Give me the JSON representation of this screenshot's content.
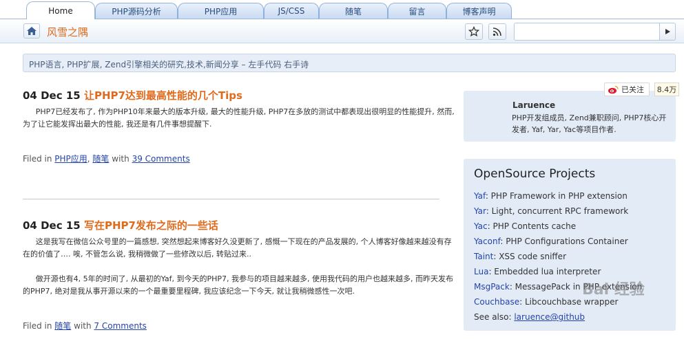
{
  "tabs": [
    {
      "label": "Home",
      "active": true
    },
    {
      "label": "PHP源码分析",
      "active": false
    },
    {
      "label": "PHP应用",
      "active": false
    },
    {
      "label": "JS/CSS",
      "active": false
    },
    {
      "label": "随笔",
      "active": false
    },
    {
      "label": "留言",
      "active": false
    },
    {
      "label": "博客声明",
      "active": false
    }
  ],
  "header": {
    "site_title": "风雪之隅",
    "search_placeholder": ""
  },
  "tagline": "PHP语言, PHP扩展, Zend引擎相关的研究,技术,新闻分享 – 左手代码 右手诗",
  "posts": [
    {
      "date": "04 Dec 15",
      "title": "让PHP7达到最高性能的几个Tips",
      "paragraphs": [
        "PHP7已经发布了, 作为PHP10年来最大的版本升级, 最大的性能升级, PHP7在多放的测试中都表现出很明显的性能提升, 然而, 为了让它能发挥出最大的性能, 我还是有几件事想提醒下."
      ],
      "filed_prefix": "Filed in",
      "categories": [
        "PHP应用",
        "随笔"
      ],
      "with_text": "with",
      "comments": "39 Comments"
    },
    {
      "date": "04 Dec 15",
      "title": "写在PHP7发布之际的一些话",
      "paragraphs": [
        "这是我写在微信公众号里的一篇感想, 突然想起来博客好久没更新了, 感慨一下现在的产品发展的, 个人博客好像越来越没有存在的价值了…. 唉, 不管怎么说, 我稍微做了一些修改以后, 转贴过来..",
        "做开源也有4, 5年的时间了, 从最初的Yaf, 到今天的PHP7, 我参与的项目越来越多, 使用我代码的用户也越来越多, 而昨天发布的PHP7, 绝对是我从事开源以来的一个最重要里程碑, 我应该纪念一下今天, 就让我稍微感性一次吧."
      ],
      "filed_prefix": "Filed in",
      "categories": [
        "随笔"
      ],
      "with_text": "with",
      "comments": "7 Comments"
    }
  ],
  "sidebar": {
    "weibo_follow": "已关注",
    "weibo_count": "8.4万",
    "profile_name": "Laruence",
    "profile_desc": "PHP开发组成员, Zend兼职顾问, PHP7核心开发者, Yaf, Yar, Yac等项目作者.",
    "opensource_title": "OpenSource Projects",
    "projects": [
      {
        "name": "Yaf",
        "desc": ": PHP Framework in PHP extension"
      },
      {
        "name": "Yar",
        "desc": ": Light, concurrent RPC framework"
      },
      {
        "name": "Yac",
        "desc": ": PHP Contents cache"
      },
      {
        "name": "Yaconf",
        "desc": ": PHP Configurations Container"
      },
      {
        "name": "Taint",
        "desc": ": XSS code sniffer"
      },
      {
        "name": "Lua",
        "desc": ": Embedded lua interpreter"
      },
      {
        "name": "MsgPack",
        "desc": ": MessagePack in PHP extension"
      },
      {
        "name": "Couchbase",
        "desc": ": Libcouchbase wrapper"
      }
    ],
    "see_also_label": "See also: ",
    "see_also_link": "laruence@github"
  },
  "watermark": "Bai 经验",
  "icons": {
    "home": "home-icon",
    "bookmark": "star-icon",
    "rss": "rss-icon",
    "search": "play-arrow-icon",
    "weibo": "weibo-icon"
  },
  "colors": {
    "accent": "#e06a1c",
    "link": "#2244aa",
    "panel": "#e3ebf7",
    "tab_border": "#8fb0d9"
  }
}
